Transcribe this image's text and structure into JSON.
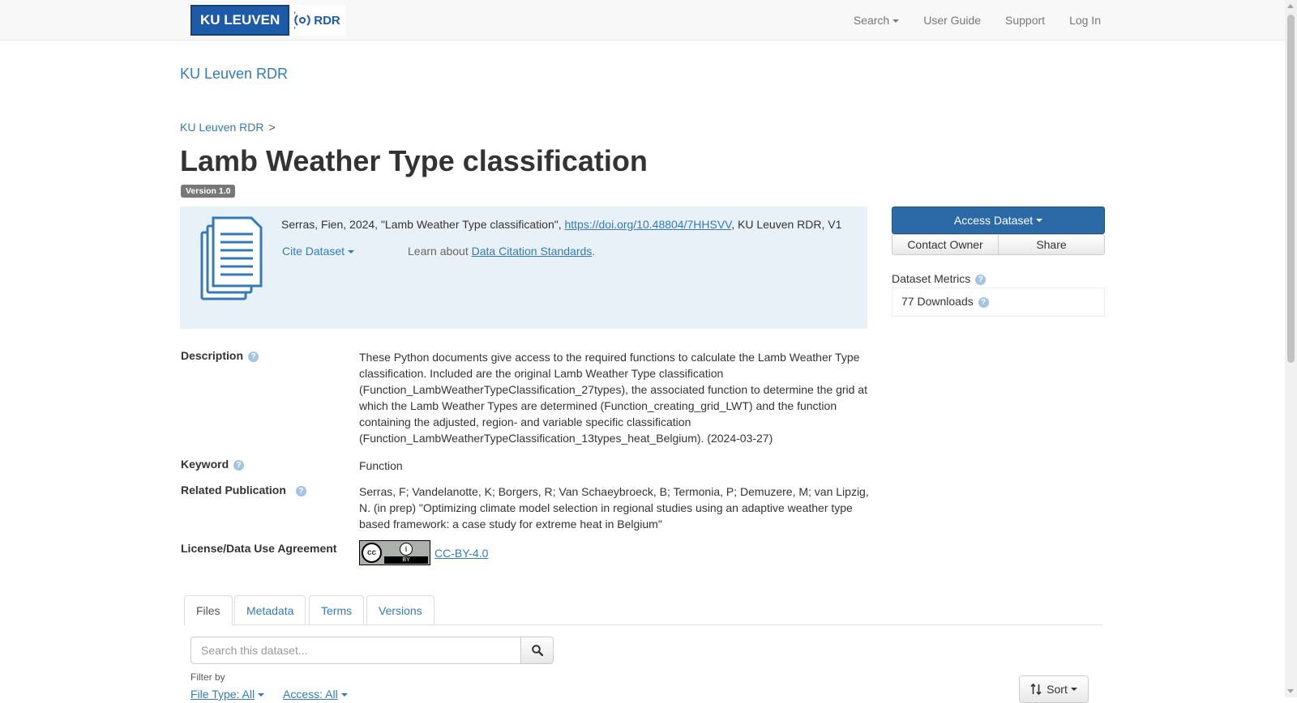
{
  "navbar": {
    "logo_ku": "KU LEUVEN",
    "logo_rdr": "RDR",
    "menu": [
      {
        "label": "Search",
        "has_caret": true
      },
      {
        "label": "User Guide"
      },
      {
        "label": "Support"
      },
      {
        "label": "Log In"
      }
    ]
  },
  "dataverse_name": "KU Leuven RDR",
  "breadcrumb": {
    "root": "KU Leuven RDR",
    "separator": ">"
  },
  "dataset": {
    "title": "Lamb Weather Type classification",
    "version_badge": "Version 1.0"
  },
  "citation": {
    "text_before": "Serras, Fien, 2024, \"Lamb Weather Type classification\", ",
    "doi": "https://doi.org/10.48804/7HHSVV",
    "text_after": ", KU Leuven RDR, V1",
    "cite_dropdown": "Cite Dataset",
    "learn_prefix": "Learn about ",
    "learn_link": "Data Citation Standards",
    "learn_suffix": "."
  },
  "actions": {
    "access_dataset": "Access Dataset",
    "contact_owner": "Contact Owner",
    "share": "Share"
  },
  "metrics": {
    "title": "Dataset Metrics",
    "downloads": "77 Downloads"
  },
  "metadata": {
    "description_label": "Description",
    "description": "These Python documents give access to the required functions to calculate the Lamb Weather Type classification. Included are the original Lamb Weather Type classification (Function_LambWeatherTypeClassification_27types), the associated function to determine the grid at which the Lamb Weather Types are determined (Function_creating_grid_LWT) and the function containing the adjusted, region- and variable specific classification (Function_LambWeatherTypeClassification_13types_heat_Belgium). (2024-03-27)",
    "keyword_label": "Keyword",
    "keyword": "Function",
    "related_pub_label": "Related Publication",
    "related_pub": "Serras, F; Vandelanotte, K; Borgers, R; Van Schaeybroeck, B; Termonia, P; Demuzere, M; van Lipzig, N. (in prep) \"Optimizing climate model selection in regional studies using an adaptive weather type based framework: a case study for extreme heat in Belgium\"",
    "license_label": "License/Data Use Agreement",
    "license": "CC-BY-4.0",
    "license_badge": {
      "cc": "cc",
      "by": "BY",
      "person": "i"
    }
  },
  "tabs": [
    "Files",
    "Metadata",
    "Terms",
    "Versions"
  ],
  "active_tab": "Files",
  "files": {
    "search_placeholder": "Search this dataset...",
    "filter_label": "Filter by",
    "file_type_filter": "File Type: All",
    "access_filter": "Access: All",
    "sort_label": "Sort"
  },
  "colors": {
    "link": "#337ab7",
    "primary_button": "#2b6aa6",
    "citation_bg": "#e9f1f8",
    "logo_blue": "#1d5aa8",
    "version_badge": "#777777"
  }
}
